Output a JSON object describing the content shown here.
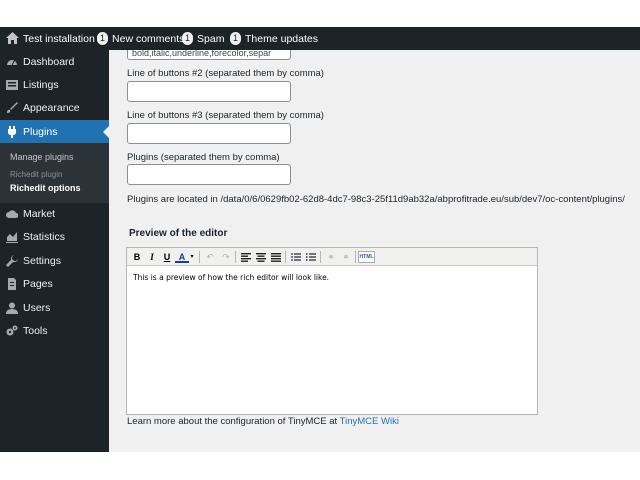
{
  "topbar": {
    "site_title": "Test installation",
    "comments_count": "1",
    "comments_label": "New comments",
    "spam_count": "1",
    "spam_label": "Spam",
    "theme_count": "1",
    "theme_label": "Theme updates"
  },
  "sidebar": {
    "items": [
      {
        "label": "Dashboard",
        "icon": "dashboard-icon"
      },
      {
        "label": "Listings",
        "icon": "listings-icon"
      },
      {
        "label": "Appearance",
        "icon": "brush-icon"
      },
      {
        "label": "Plugins",
        "icon": "plugin-icon"
      },
      {
        "label": "Market",
        "icon": "cloud-icon"
      },
      {
        "label": "Statistics",
        "icon": "chart-icon"
      },
      {
        "label": "Settings",
        "icon": "wrench-icon"
      },
      {
        "label": "Pages",
        "icon": "page-icon"
      },
      {
        "label": "Users",
        "icon": "user-icon"
      },
      {
        "label": "Tools",
        "icon": "gears-icon"
      }
    ],
    "submenu": {
      "manage": "Manage plugins",
      "richedit_plugin": "Richedit plugin",
      "richedit_options": "Richedit options"
    }
  },
  "form": {
    "buttons1_value": "bold,italic,underline,forecolor,separ",
    "buttons2_label": "Line of buttons #2 (separated them by comma)",
    "buttons2_value": "",
    "buttons3_label": "Line of buttons #3 (separated them by comma)",
    "buttons3_value": "",
    "plugins_label": "Plugins (separated them by comma)",
    "plugins_value": "",
    "plugins_location": "Plugins are located in /data/0/6/0629fb02-62d8-4dc7-98c3-25f11d9ab32a/abprofitrade.eu/sub/dev7/oc-content/plugins/"
  },
  "preview": {
    "title": "Preview of the editor",
    "body_text": "This is a preview of how the rich editor will look like.",
    "toolbar": {
      "bold": "B",
      "italic": "I",
      "underline": "U",
      "forecolor": "A",
      "html": "HTML"
    }
  },
  "footer": {
    "learn_more": "Learn more about the configuration of TinyMCE at",
    "link_text": "TinyMCE Wiki"
  },
  "colors": {
    "admin_bar": "#1d2327",
    "active_menu": "#2271b1",
    "content_bg": "#f0f0f1",
    "link": "#2271b1"
  }
}
